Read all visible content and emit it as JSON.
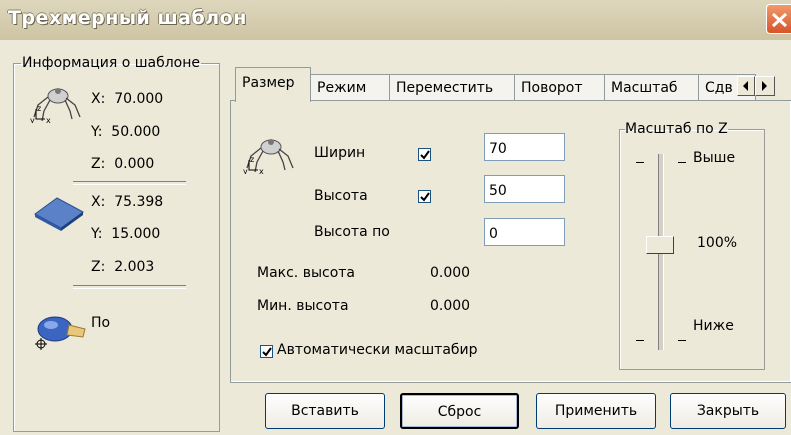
{
  "window": {
    "title": "Трехмерный шаблон"
  },
  "info_group": {
    "legend": "Информация о шаблоне",
    "model_coords": {
      "x": "X:  70.000",
      "y": "Y:  50.000",
      "z": "Z:  0.000"
    },
    "material_coords": {
      "x": "X:  75.398",
      "y": "Y:  15.000",
      "z": "Z:  2.003"
    },
    "tool_label": "По"
  },
  "tabs": [
    {
      "label": "Размер"
    },
    {
      "label": "Режим"
    },
    {
      "label": "Переместить"
    },
    {
      "label": "Поворот"
    },
    {
      "label": "Масштаб"
    },
    {
      "label": "Сдв"
    }
  ],
  "size_panel": {
    "width_label": "Ширин",
    "width_checked": true,
    "width_value": "70",
    "height_label": "Высота",
    "height_checked": true,
    "height_value": "50",
    "height_po_label": "Высота по",
    "height_po_value": "0",
    "max_height_label": "Макс. высота",
    "max_height_value": "0.000",
    "min_height_label": "Мин. высота",
    "min_height_value": "0.000",
    "auto_scale_label": "Автоматически масштабир",
    "auto_scale_checked": true
  },
  "z_scale": {
    "legend": "Масштаб по Z",
    "top_label": "Выше",
    "value_label": "100%",
    "bottom_label": "Ниже",
    "slider_level": 0.5
  },
  "buttons": {
    "insert": "Вставить",
    "reset": "Сброс",
    "apply": "Применить",
    "close": "Закрыть"
  },
  "colors": {
    "dialog_bg": "#ece9d8",
    "close_button": "#d8542a",
    "check_mark": "#21a121"
  },
  "icons": [
    "spider-model-icon",
    "material-block-icon",
    "tool-icon",
    "close-icon",
    "arrow-left-icon",
    "arrow-right-icon",
    "check-icon"
  ]
}
